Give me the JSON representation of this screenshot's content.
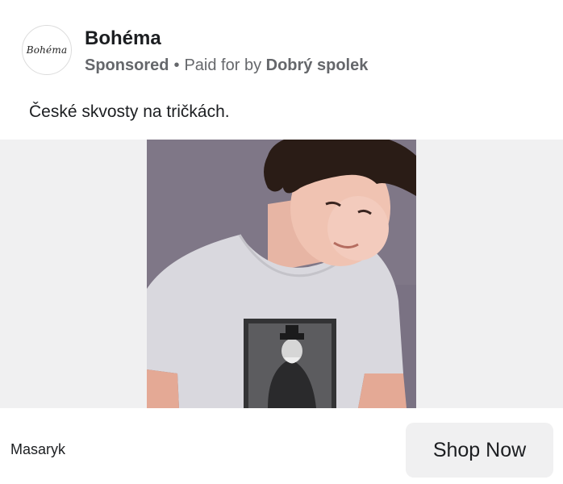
{
  "post": {
    "page_name": "Bohéma",
    "avatar_logo_text": "Bohéma",
    "sponsored_label": "Sponsored",
    "separator": "•",
    "paid_for_prefix": "Paid for by",
    "paid_for_by": "Dobrý spolek",
    "ad_text": "České skvosty na tričkách."
  },
  "media": {
    "image_description_icon": "photo-man-in-tshirt"
  },
  "footer": {
    "caption": "Masaryk",
    "cta_label": "Shop Now"
  },
  "colors": {
    "secondary_text": "#65676b",
    "media_background": "#f0f0f1",
    "button_background": "#f0f0f1"
  }
}
